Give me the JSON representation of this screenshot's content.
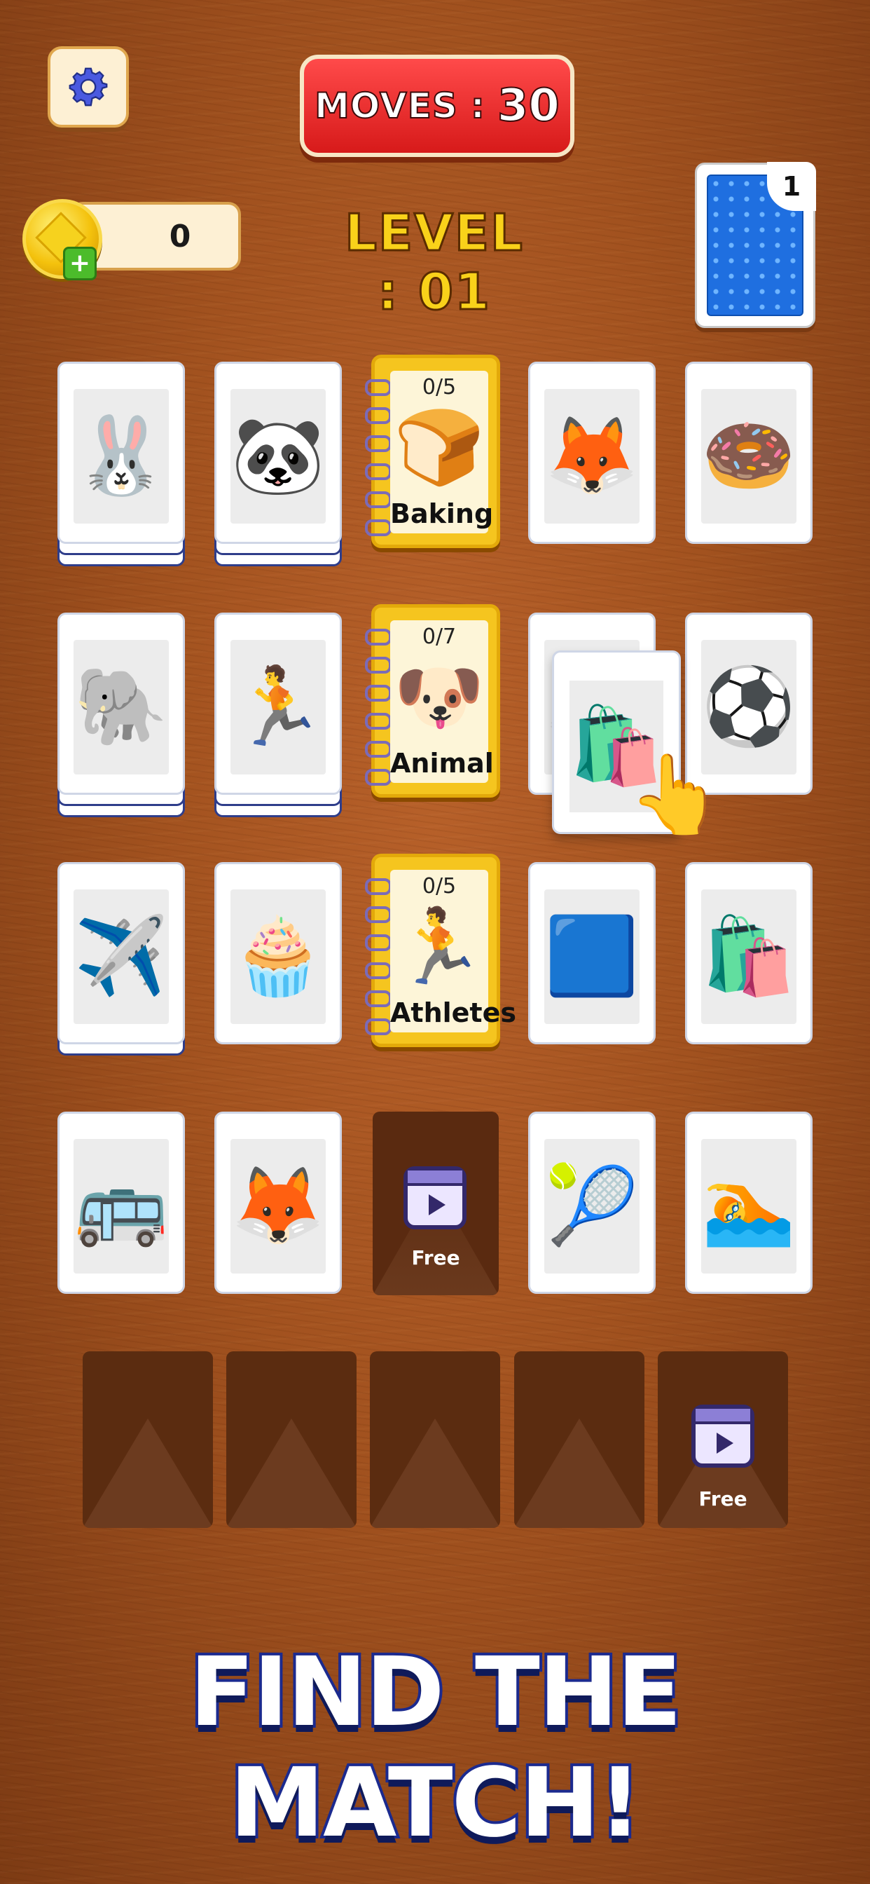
{
  "hud": {
    "moves_label": "MOVES",
    "moves_separator": ":",
    "moves_value": "30",
    "coins": "0",
    "level_label": "LEVEL : 01",
    "deck_count": "1"
  },
  "board": {
    "row1": [
      {
        "icon": "🐰",
        "name": "bunny"
      },
      {
        "icon": "🐼",
        "name": "panda"
      },
      {
        "album_count": "0/5",
        "album_icon": "🍞",
        "album_name": "Baking"
      },
      {
        "icon": "🦊",
        "name": "fox"
      },
      {
        "icon": "🍩",
        "name": "donut"
      }
    ],
    "row2": [
      {
        "icon": "🐘",
        "name": "elephant"
      },
      {
        "icon": "🏃",
        "name": "runner"
      },
      {
        "album_count": "0/7",
        "album_icon": "🐶",
        "album_name": "Animal"
      },
      {
        "icon": "🦊",
        "name": "hidden-card"
      },
      {
        "icon": "⚽",
        "name": "soccer-player"
      }
    ],
    "row3": [
      {
        "icon": "✈️",
        "name": "airplane"
      },
      {
        "icon": "🧁",
        "name": "cupcake"
      },
      {
        "album_count": "0/5",
        "album_icon": "🏃",
        "album_name": "Athletes"
      },
      {
        "icon": "🟦",
        "name": "oven"
      },
      {
        "icon": "🛍️",
        "name": "flour-bag"
      }
    ],
    "row4": [
      {
        "icon": "🚌",
        "name": "school-bus"
      },
      {
        "icon": "🦊",
        "name": "fox"
      },
      {
        "free_label": "Free"
      },
      {
        "icon": "🎾",
        "name": "tennis-player"
      },
      {
        "icon": "🏊",
        "name": "swimmer"
      }
    ]
  },
  "floating_card": {
    "icon": "🛍️",
    "name": "flour-bag"
  },
  "tray": {
    "free_label": "Free"
  },
  "headline": "FIND THE MATCH!"
}
